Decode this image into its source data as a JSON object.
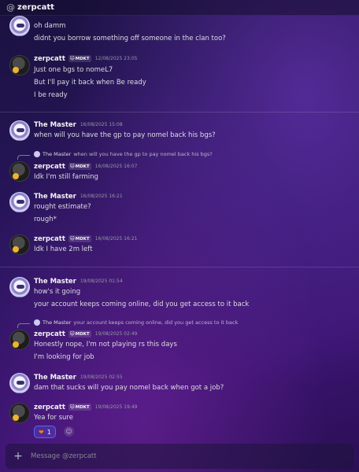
{
  "header": {
    "at_symbol": "@",
    "title": "zerpcatt"
  },
  "messages": [
    {
      "type": "continuation",
      "text": "oh damm"
    },
    {
      "type": "continuation",
      "text": "didnt you borrow something off someone in the clan too?"
    },
    {
      "type": "group",
      "author": "zerpcatt",
      "tag_icon": "🐱",
      "tag": "MDKT",
      "timestamp": "12/08/2025 23:05",
      "lines": [
        "Just one bgs to nomeL7",
        "But I'll pay it back when Be ready",
        "I be ready"
      ]
    },
    {
      "type": "group",
      "author": "The Master",
      "timestamp": "16/08/2025 15:08",
      "lines": [
        "when will you have the gp to pay nomel back his bgs?"
      ]
    },
    {
      "type": "group",
      "author": "zerpcatt",
      "tag_icon": "🐱",
      "tag": "MDKT",
      "timestamp": "16/08/2025 16:07",
      "reply": {
        "author": "The Master",
        "text": "when will you have the gp to pay nomel back his bgs?"
      },
      "lines": [
        "Idk I'm still farming"
      ]
    },
    {
      "type": "group",
      "author": "The Master",
      "timestamp": "16/08/2025 16:21",
      "lines": [
        "rought estimate?",
        "rough*"
      ]
    },
    {
      "type": "group",
      "author": "zerpcatt",
      "tag_icon": "🐱",
      "tag": "MDKT",
      "timestamp": "16/08/2025 16:21",
      "lines": [
        "Idk I have 2m left"
      ]
    },
    {
      "type": "group",
      "author": "The Master",
      "timestamp": "19/08/2025 01:54",
      "lines": [
        "how's it going",
        "your account keeps coming online, did you get access to it back"
      ]
    },
    {
      "type": "group",
      "author": "zerpcatt",
      "tag_icon": "🐱",
      "tag": "MDKT",
      "timestamp": "19/08/2025 02:49",
      "reply": {
        "author": "The Master",
        "text": "your account keeps coming online, did you get access to it back"
      },
      "lines": [
        "Honestly nope, I'm not playing rs this days",
        "I'm looking for job"
      ]
    },
    {
      "type": "group",
      "author": "The Master",
      "timestamp": "19/08/2025 02:55",
      "lines": [
        "dam that sucks will you pay nomel back when got a job?"
      ]
    },
    {
      "type": "group",
      "author": "zerpcatt",
      "tag_icon": "🐱",
      "tag": "MDKT",
      "timestamp": "19/08/2025 19:49",
      "lines": [
        "Yea for sure"
      ]
    }
  ],
  "reaction": {
    "emoji": "❤",
    "count": "1",
    "add_glyph": "☺"
  },
  "composer": {
    "plus_glyph": "+",
    "placeholder": "Message @zerpcatt"
  },
  "colors": {
    "accent": "#5865f2",
    "tag_bg": "#3a3d44",
    "timestamp": "#949ba4"
  }
}
